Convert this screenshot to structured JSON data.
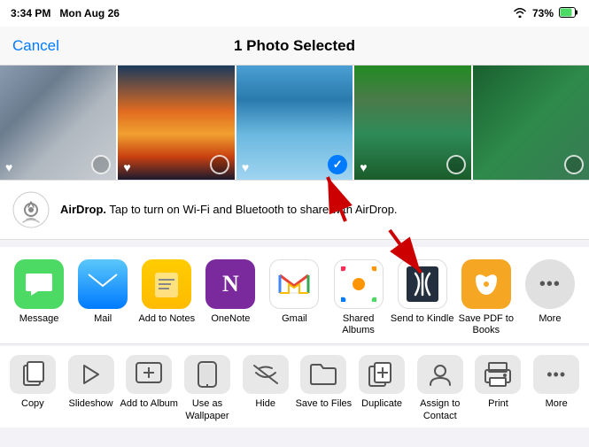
{
  "statusBar": {
    "time": "3:34 PM",
    "day": "Mon Aug 26",
    "wifi": "WiFi",
    "battery": "73%"
  },
  "navBar": {
    "cancelLabel": "Cancel",
    "title": "1 Photo Selected"
  },
  "photos": [
    {
      "id": "photo-1",
      "selected": false,
      "hasHeart": true
    },
    {
      "id": "photo-2",
      "selected": false,
      "hasHeart": true
    },
    {
      "id": "photo-3",
      "selected": true,
      "hasHeart": true
    },
    {
      "id": "photo-4",
      "selected": false,
      "hasHeart": true
    },
    {
      "id": "photo-5",
      "selected": false,
      "hasHeart": false
    }
  ],
  "airdrop": {
    "title": "AirDrop.",
    "description": " Tap to turn on Wi-Fi and Bluetooth to share with AirDrop."
  },
  "apps": [
    {
      "id": "message",
      "label": "Message",
      "emoji": "💬",
      "colorClass": "icon-message"
    },
    {
      "id": "mail",
      "label": "Mail",
      "emoji": "✉️",
      "colorClass": "icon-mail"
    },
    {
      "id": "add-to-notes",
      "label": "Add to Notes",
      "emoji": "📝",
      "colorClass": "icon-notes"
    },
    {
      "id": "onenote",
      "label": "OneNote",
      "emoji": "N",
      "colorClass": "icon-onenote"
    },
    {
      "id": "gmail",
      "label": "Gmail",
      "emoji": "M",
      "colorClass": "icon-gmail"
    },
    {
      "id": "shared-albums",
      "label": "Shared Albums",
      "emoji": "🌸",
      "colorClass": "icon-photos"
    },
    {
      "id": "send-to-kindle",
      "label": "Send to Kindle",
      "emoji": "📖",
      "colorClass": "icon-kindle"
    },
    {
      "id": "save-pdf-books",
      "label": "Save PDF to Books",
      "emoji": "📚",
      "colorClass": "icon-books"
    },
    {
      "id": "more-apps",
      "label": "More",
      "emoji": "•••",
      "colorClass": "icon-more-apps"
    }
  ],
  "actions": [
    {
      "id": "copy",
      "label": "Copy",
      "icon": "copy"
    },
    {
      "id": "slideshow",
      "label": "Slideshow",
      "icon": "play"
    },
    {
      "id": "add-to-album",
      "label": "Add to Album",
      "icon": "plus-square"
    },
    {
      "id": "use-as-wallpaper",
      "label": "Use as Wallpaper",
      "icon": "device"
    },
    {
      "id": "hide",
      "label": "Hide",
      "icon": "eye-slash"
    },
    {
      "id": "save-to-files",
      "label": "Save to Files",
      "icon": "folder"
    },
    {
      "id": "duplicate",
      "label": "Duplicate",
      "icon": "plus-square-2"
    },
    {
      "id": "assign-contact",
      "label": "Assign to Contact",
      "icon": "person"
    },
    {
      "id": "print",
      "label": "Print",
      "icon": "printer"
    },
    {
      "id": "more-actions",
      "label": "More",
      "icon": "dots"
    }
  ]
}
